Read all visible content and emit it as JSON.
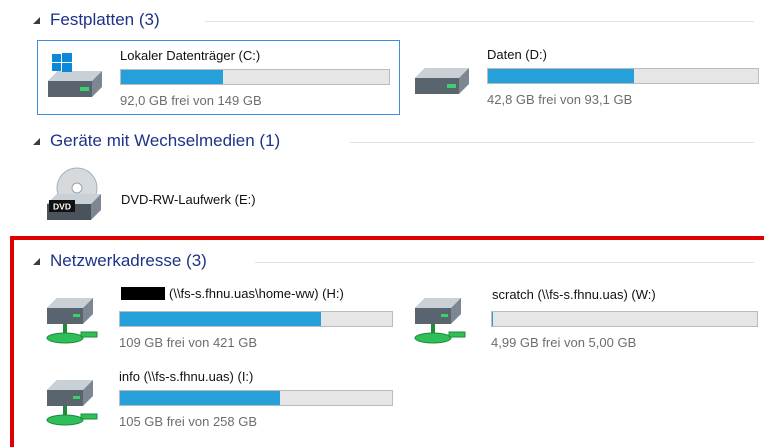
{
  "groups": {
    "hard_drives": {
      "title": "Festplatten (3)"
    },
    "removable": {
      "title": "Geräte mit Wechselmedien (1)"
    },
    "network": {
      "title": "Netzwerkadresse (3)"
    }
  },
  "drives": {
    "c": {
      "name": "Lokaler Datenträger (C:)",
      "info": "92,0 GB frei von 149 GB",
      "used_fraction": 0.38,
      "icon": "windows-hard-drive-icon"
    },
    "d": {
      "name": "Daten (D:)",
      "info": "42,8 GB frei von 93,1 GB",
      "used_fraction": 0.54,
      "icon": "hard-drive-icon"
    },
    "e": {
      "name": "DVD-RW-Laufwerk (E:)",
      "icon": "dvd-drive-icon",
      "icon_label": "DVD"
    },
    "h": {
      "name": "(\\\\fs-s.fhnu.uas\\home-ww) (H:)",
      "info": "109 GB frei von 421 GB",
      "used_fraction": 0.74,
      "icon": "network-drive-icon"
    },
    "w": {
      "name": "scratch (\\\\fs-s.fhnu.uas) (W:)",
      "info": "4,99 GB frei von 5,00 GB",
      "used_fraction": 0.002,
      "icon": "network-drive-icon"
    },
    "i": {
      "name": "info (\\\\fs-s.fhnu.uas) (I:)",
      "info": "105 GB frei von 258 GB",
      "used_fraction": 0.59,
      "icon": "network-drive-icon"
    }
  },
  "colors": {
    "group_title": "#1e3287",
    "bar_fill": "#26a0da",
    "bar_track": "#e6e6e6",
    "selection_border": "#3c8ee0",
    "highlight_frame": "#e00000"
  }
}
